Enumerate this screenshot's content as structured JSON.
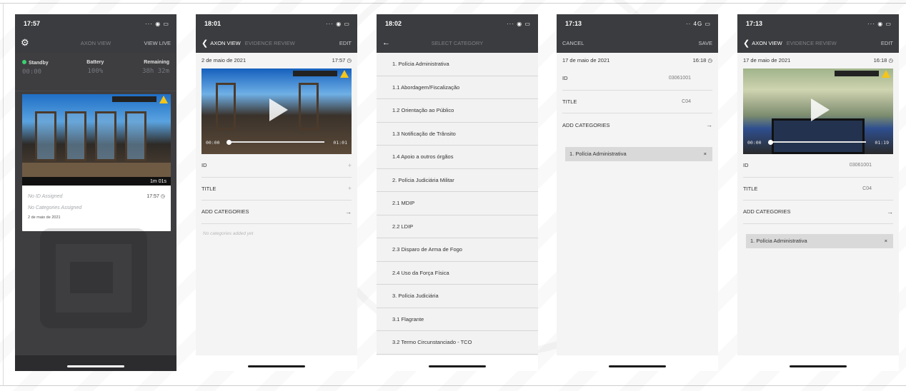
{
  "phones": [
    {
      "status_time": "17:57",
      "status_icons": "··· ◉ ▭",
      "nav": {
        "center": "AXON VIEW",
        "right": "VIEW LIVE"
      },
      "stats": [
        {
          "label": "Standby",
          "value": "00:00"
        },
        {
          "label": "Battery",
          "value": "100%"
        },
        {
          "label": "Remaining",
          "value": "38h 32m"
        }
      ],
      "card": {
        "duration": "1m 01s",
        "id_text": "No ID Assigned",
        "time": "17:57",
        "categories_text": "No Categories Assigned",
        "date": "2 de maio de 2021"
      }
    },
    {
      "status_time": "18:01",
      "status_icons": "··· ◉ ▭",
      "nav": {
        "left": "AXON VIEW",
        "crumb": "EVIDENCE REVIEW",
        "right": "EDIT"
      },
      "date": "2 de maio de 2021",
      "time": "17:57",
      "video": {
        "start": "00:00",
        "end": "01:01"
      },
      "rows": [
        {
          "label": "ID",
          "value": "",
          "icon": "+"
        },
        {
          "label": "TITLE",
          "value": "",
          "icon": "+"
        },
        {
          "label": "ADD CATEGORIES",
          "value": "",
          "icon": "→"
        }
      ],
      "empty": "No categories added yet"
    },
    {
      "status_time": "18:02",
      "status_icons": "··· ◉ ▭",
      "nav": {
        "center": "SELECT CATEGORY"
      },
      "categories": [
        "1. Polícia Administrativa",
        "1.1 Abordagem/Fiscalização",
        "1.2 Orientação ao Público",
        "1.3 Notificação de Trânsito",
        "1.4 Apoio a outros órgãos",
        "2. Polícia Judiciária Militar",
        "2.1 MDIP",
        "2.2 LDIP",
        "2.3 Disparo de Arma de Fogo",
        "2.4 Uso da Força Física",
        "3. Polícia Judiciária",
        "3.1 Flagrante",
        "3.2 Termo Circunstanciado - TCO"
      ]
    },
    {
      "status_time": "17:13",
      "status_icons": "·· 4G ▭",
      "nav": {
        "left": "CANCEL",
        "right": "SAVE"
      },
      "date": "17 de maio de 2021",
      "time": "16:18",
      "rows": [
        {
          "label": "ID",
          "value": "03061001",
          "icon": ""
        },
        {
          "label": "TITLE",
          "value": "C04",
          "icon": ""
        },
        {
          "label": "ADD CATEGORIES",
          "value": "",
          "icon": "→"
        }
      ],
      "chip": "1. Polícia Administrativa"
    },
    {
      "status_time": "17:13",
      "status_icons": "··· ◉ ▭",
      "nav": {
        "left": "AXON VIEW",
        "crumb": "EVIDENCE REVIEW",
        "right": "EDIT"
      },
      "date": "17 de maio de 2021",
      "time": "16:18",
      "video": {
        "start": "00:00",
        "end": "01:19"
      },
      "rows": [
        {
          "label": "ID",
          "value": "03061001",
          "icon": ""
        },
        {
          "label": "TITLE",
          "value": "C04",
          "icon": ""
        },
        {
          "label": "ADD CATEGORIES",
          "value": "",
          "icon": "→"
        }
      ],
      "chip": "1. Polícia Administrativa"
    }
  ],
  "colors": {
    "accent_green": "#3bd16f",
    "header_dark": "#3b3c3f",
    "warning": "#f5c518"
  }
}
